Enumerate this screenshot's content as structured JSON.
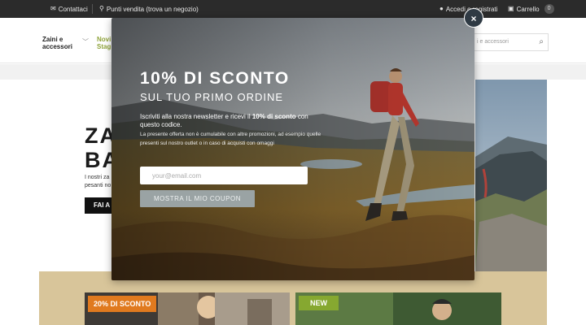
{
  "topbar": {
    "contact": "Contattaci",
    "stores": "Punti vendita (trova un negozio)",
    "account": "Accedi o registrati",
    "cart": "Carrello",
    "cart_count": "0"
  },
  "header": {
    "nav_item_1": "Zaini e accessori",
    "nav_item_2": "Novi Stag",
    "search_placeholder": "i e accessori"
  },
  "hero": {
    "title_line1": "ZA",
    "title_line2": "BA",
    "desc_line1": "I nostri za",
    "desc_line2": "pesanti no",
    "cta": "FAI A"
  },
  "cards": {
    "tag_sale": "20% DI SCONTO",
    "tag_new": "NEW"
  },
  "modal": {
    "title": "10% DI SCONTO",
    "subtitle": "SUL TUO PRIMO ORDINE",
    "text_prefix": "Iscriviti alla nostra newsletter e ricevi il ",
    "text_bold1": "10% di sconto",
    "text_suffix": " con questo codice.",
    "small_text": "La presente offerta non è cumulabile con altre promozioni, ad esempio quelle presenti sul nostro outlet o in caso di acquisti con omaggi",
    "email_placeholder": "your@email.com",
    "button": "MOSTRA IL MIO COUPON",
    "close": "×"
  },
  "colors": {
    "topbar_bg": "#2b2b2b",
    "sale_tag": "#e07a1f",
    "new_tag": "#86a830",
    "nav_accent": "#8fa33a",
    "tan_section": "#d8c59a"
  }
}
